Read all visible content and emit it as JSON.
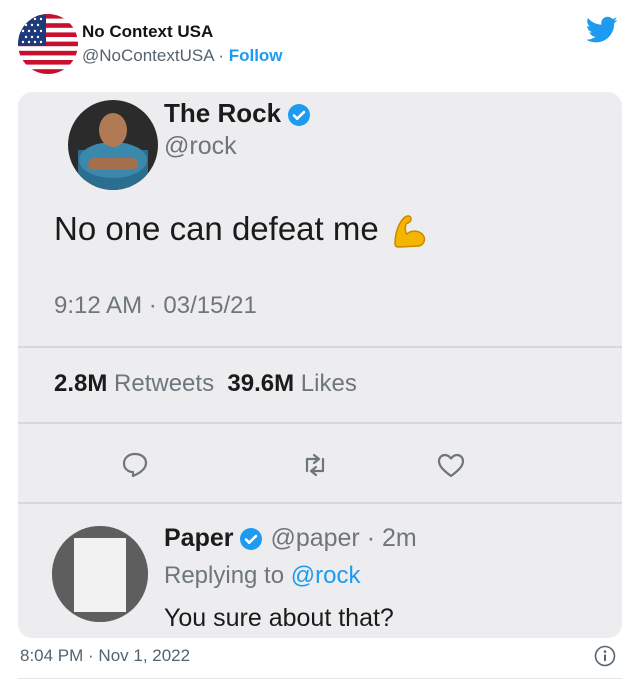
{
  "header": {
    "author_name": "No Context USA",
    "author_handle": "@NoContextUSA",
    "separator": " · ",
    "follow_label": "Follow"
  },
  "embedded": {
    "name": "The Rock",
    "handle": "@rock",
    "text": "No one can defeat me",
    "timestamp": "9:12 AM · 03/15/21",
    "retweets_count": "2.8M",
    "retweets_label": "Retweets",
    "likes_count": "39.6M",
    "likes_label": "Likes",
    "reply": {
      "name": "Paper",
      "handle_time": "@paper · 2m",
      "replying_prefix": "Replying to ",
      "replying_mention": "@rock",
      "text": "You sure about that?"
    }
  },
  "footer": {
    "timestamp": "8:04 PM · Nov 1, 2022"
  },
  "icons": {
    "brand": "twitter-bird-icon",
    "verified": "verified-badge-icon",
    "emoji": "flexed-biceps-icon",
    "actions": [
      "reply-icon",
      "retweet-icon",
      "like-icon"
    ],
    "info": "info-icon"
  },
  "colors": {
    "accent": "#1d9bf0",
    "text": "#0f1419",
    "secondary": "#536471",
    "card_background": "#ededef"
  }
}
